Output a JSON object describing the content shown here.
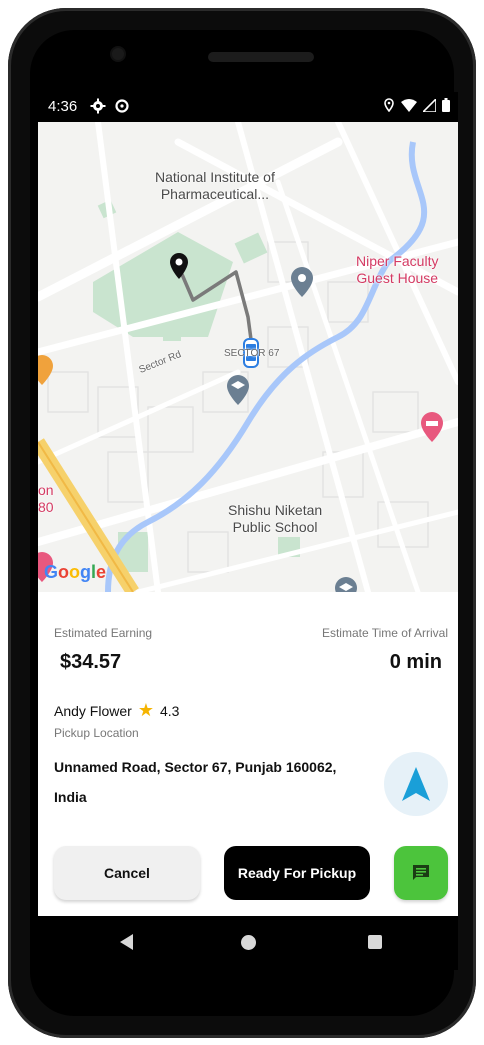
{
  "status_bar": {
    "time": "4:36",
    "icons_left": [
      "gear-icon",
      "data-saver-icon"
    ],
    "icons_right": [
      "location-icon",
      "wifi-icon",
      "signal-icon",
      "battery-icon"
    ]
  },
  "map": {
    "labels": {
      "national_institute_1": "National Institute of",
      "national_institute_2": "Pharmaceutical...",
      "niper_1": "Niper Faculty",
      "niper_2": "Guest House",
      "sector_rd": "Sector Rd",
      "sector67": "SECTOR 67",
      "shishu_1": "Shishu Niketan",
      "shishu_2": "Public School",
      "left_partial_1": "on",
      "left_partial_2": "80"
    },
    "google_logo": [
      "G",
      "o",
      "o",
      "g",
      "l",
      "e"
    ],
    "colors": {
      "park": "#c9e4cf",
      "water": "#a8c7fa",
      "highway": "#f6d16b",
      "route": "#777777",
      "poi_grey": "#6b7f92",
      "poi_pink": "#e8587e"
    }
  },
  "trip": {
    "earning_label": "Estimated Earning",
    "earning_value": "$34.57",
    "eta_label": "Estimate Time of Arrival",
    "eta_value": "0 min",
    "driver_name": "Andy Flower",
    "rating": "4.3",
    "pickup_label": "Pickup Location",
    "pickup_address": "Unnamed Road, Sector 67, Punjab 160062, India"
  },
  "actions": {
    "cancel_label": "Cancel",
    "ready_label": "Ready For Pickup",
    "chat_icon": "chat-icon",
    "navigate_icon": "navigation-arrow-icon"
  },
  "colors": {
    "accent_blue": "#1a9fd8",
    "chat_green": "#4cc43c",
    "star_yellow": "#f5b400"
  }
}
